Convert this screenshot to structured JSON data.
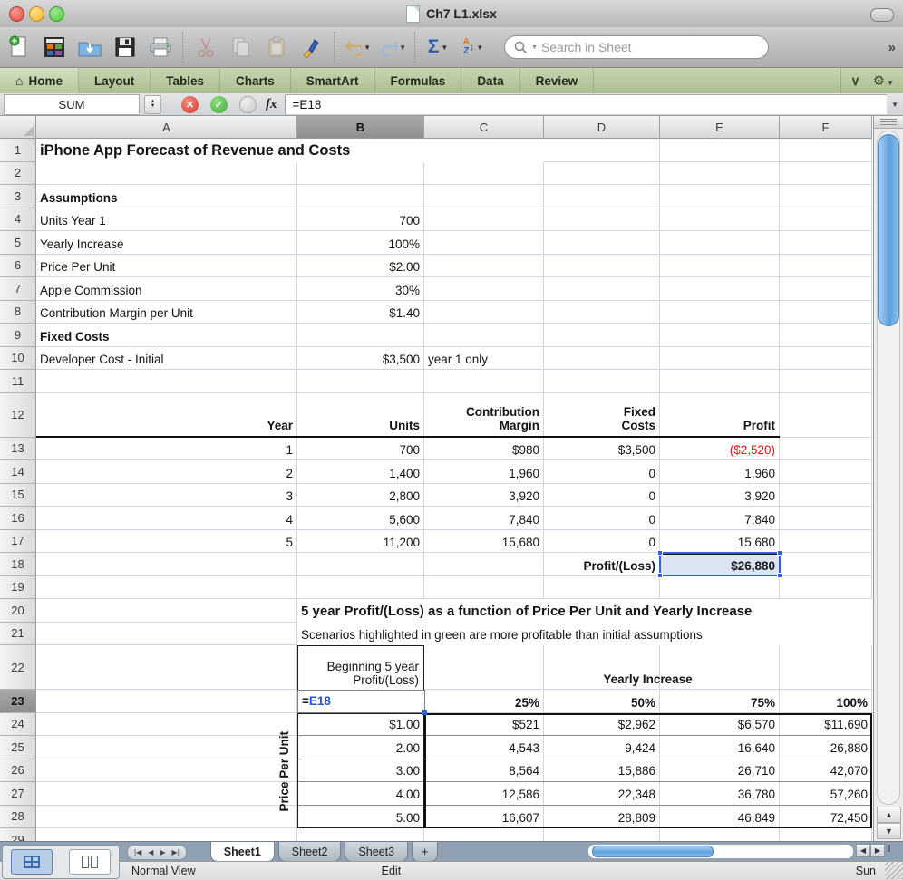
{
  "window": {
    "title": "Ch7 L1.xlsx"
  },
  "toolbar": {
    "search_placeholder": "Search in Sheet",
    "more_label": "»",
    "icons": [
      "new-document",
      "workbook-gallery",
      "open",
      "save",
      "print",
      "cut",
      "copy",
      "paste",
      "format-painter",
      "undo",
      "redo",
      "autosum",
      "sort-az",
      "search"
    ]
  },
  "ribbon": {
    "tabs": [
      "Home",
      "Layout",
      "Tables",
      "Charts",
      "SmartArt",
      "Formulas",
      "Data",
      "Review"
    ],
    "active_tab": "Home",
    "home_icon": "⌂",
    "collapse_icon": "∨",
    "gear_icon": "⚙"
  },
  "formula_bar": {
    "name_box": "SUM",
    "fx_label": "fx",
    "formula": "=E18",
    "edit_prefix": "=",
    "edit_ref": "E18"
  },
  "sheet": {
    "columns": [
      "A",
      "B",
      "C",
      "D",
      "E",
      "F"
    ],
    "selected_column": "B",
    "selected_row": 23,
    "row_count": 29,
    "vertical_label": "Price Per Unit",
    "cells": [
      {
        "r": 1,
        "c": "A",
        "t": "iPhone App Forecast of Revenue and Costs",
        "cls": "b t16 wbg",
        "span": 3
      },
      {
        "r": 3,
        "c": "A",
        "t": "Assumptions",
        "cls": "b"
      },
      {
        "r": 4,
        "c": "A",
        "t": "Units Year 1"
      },
      {
        "r": 4,
        "c": "B",
        "t": "700",
        "cls": "ar"
      },
      {
        "r": 5,
        "c": "A",
        "t": "Yearly Increase"
      },
      {
        "r": 5,
        "c": "B",
        "t": "100%",
        "cls": "ar"
      },
      {
        "r": 6,
        "c": "A",
        "t": "Price Per Unit"
      },
      {
        "r": 6,
        "c": "B",
        "t": "$2.00",
        "cls": "ar"
      },
      {
        "r": 7,
        "c": "A",
        "t": "Apple Commission"
      },
      {
        "r": 7,
        "c": "B",
        "t": "30%",
        "cls": "ar"
      },
      {
        "r": 8,
        "c": "A",
        "t": "Contribution Margin per Unit"
      },
      {
        "r": 8,
        "c": "B",
        "t": "$1.40",
        "cls": "ar"
      },
      {
        "r": 9,
        "c": "A",
        "t": "Fixed  Costs",
        "cls": "b"
      },
      {
        "r": 10,
        "c": "A",
        "t": "Developer Cost - Initial"
      },
      {
        "r": 10,
        "c": "B",
        "t": "$3,500",
        "cls": "ar"
      },
      {
        "r": 10,
        "c": "C",
        "t": "year 1 only"
      },
      {
        "r": 12,
        "c": "A",
        "t": "Year",
        "cls": "b ar bb2"
      },
      {
        "r": 12,
        "c": "B",
        "t": "Units",
        "cls": "b ar bb2"
      },
      {
        "r": 12,
        "c": "C",
        "t": "Contribution\nMargin",
        "cls": "b ar bb2 pre"
      },
      {
        "r": 12,
        "c": "D",
        "t": "Fixed\nCosts",
        "cls": "b ar bb2 pre"
      },
      {
        "r": 12,
        "c": "E",
        "t": "Profit",
        "cls": "b ar bb2"
      },
      {
        "r": 13,
        "c": "A",
        "t": "1",
        "cls": "ar"
      },
      {
        "r": 13,
        "c": "B",
        "t": "700",
        "cls": "ar"
      },
      {
        "r": 13,
        "c": "C",
        "t": "$980",
        "cls": "ar"
      },
      {
        "r": 13,
        "c": "D",
        "t": "$3,500",
        "cls": "ar"
      },
      {
        "r": 13,
        "c": "E",
        "t": "($2,520)",
        "cls": "ar red"
      },
      {
        "r": 14,
        "c": "A",
        "t": "2",
        "cls": "ar"
      },
      {
        "r": 14,
        "c": "B",
        "t": "1,400",
        "cls": "ar"
      },
      {
        "r": 14,
        "c": "C",
        "t": "1,960",
        "cls": "ar"
      },
      {
        "r": 14,
        "c": "D",
        "t": "0",
        "cls": "ar"
      },
      {
        "r": 14,
        "c": "E",
        "t": "1,960",
        "cls": "ar"
      },
      {
        "r": 15,
        "c": "A",
        "t": "3",
        "cls": "ar"
      },
      {
        "r": 15,
        "c": "B",
        "t": "2,800",
        "cls": "ar"
      },
      {
        "r": 15,
        "c": "C",
        "t": "3,920",
        "cls": "ar"
      },
      {
        "r": 15,
        "c": "D",
        "t": "0",
        "cls": "ar"
      },
      {
        "r": 15,
        "c": "E",
        "t": "3,920",
        "cls": "ar"
      },
      {
        "r": 16,
        "c": "A",
        "t": "4",
        "cls": "ar"
      },
      {
        "r": 16,
        "c": "B",
        "t": "5,600",
        "cls": "ar"
      },
      {
        "r": 16,
        "c": "C",
        "t": "7,840",
        "cls": "ar"
      },
      {
        "r": 16,
        "c": "D",
        "t": "0",
        "cls": "ar"
      },
      {
        "r": 16,
        "c": "E",
        "t": "7,840",
        "cls": "ar"
      },
      {
        "r": 17,
        "c": "A",
        "t": "5",
        "cls": "ar"
      },
      {
        "r": 17,
        "c": "B",
        "t": "11,200",
        "cls": "ar"
      },
      {
        "r": 17,
        "c": "C",
        "t": "15,680",
        "cls": "ar"
      },
      {
        "r": 17,
        "c": "D",
        "t": "0",
        "cls": "ar"
      },
      {
        "r": 17,
        "c": "E",
        "t": "15,680",
        "cls": "ar"
      },
      {
        "r": 18,
        "c": "D",
        "t": "Profit/(Loss)",
        "cls": "b ar"
      },
      {
        "r": 18,
        "c": "E",
        "t": "$26,880",
        "cls": "b ar bt2 selfill"
      },
      {
        "r": 20,
        "c": "B",
        "t": "5 year Profit/(Loss) as a function of Price Per Unit and Yearly Increase",
        "cls": "b t15 wbg",
        "span": 5
      },
      {
        "r": 21,
        "c": "B",
        "t": "Scenarios highlighted in green are more profitable than initial assumptions",
        "cls": "wbg",
        "span": 5
      },
      {
        "r": 22,
        "c": "B",
        "t": "Beginning 5 year\nProfit/(Loss)",
        "cls": "pre ar b22box"
      },
      {
        "r": 22,
        "c": "C",
        "t": "Yearly Increase",
        "cls": "b ac",
        "span": 4
      },
      {
        "r": 23,
        "c": "C",
        "t": "25%",
        "cls": "b ar"
      },
      {
        "r": 23,
        "c": "D",
        "t": "50%",
        "cls": "b ar"
      },
      {
        "r": 23,
        "c": "E",
        "t": "75%",
        "cls": "b ar"
      },
      {
        "r": 23,
        "c": "F",
        "t": "100%",
        "cls": "b ar"
      },
      {
        "r": 24,
        "c": "B",
        "t": "$1.00",
        "cls": "ar hb"
      },
      {
        "r": 24,
        "c": "C",
        "t": "$521",
        "cls": "ar hb"
      },
      {
        "r": 24,
        "c": "D",
        "t": "$2,962",
        "cls": "ar hb"
      },
      {
        "r": 24,
        "c": "E",
        "t": "$6,570",
        "cls": "ar hb"
      },
      {
        "r": 24,
        "c": "F",
        "t": "$11,690",
        "cls": "ar hb"
      },
      {
        "r": 25,
        "c": "B",
        "t": "2.00",
        "cls": "ar hb"
      },
      {
        "r": 25,
        "c": "C",
        "t": "4,543",
        "cls": "ar hb"
      },
      {
        "r": 25,
        "c": "D",
        "t": "9,424",
        "cls": "ar hb"
      },
      {
        "r": 25,
        "c": "E",
        "t": "16,640",
        "cls": "ar hb"
      },
      {
        "r": 25,
        "c": "F",
        "t": "26,880",
        "cls": "ar hb"
      },
      {
        "r": 26,
        "c": "B",
        "t": "3.00",
        "cls": "ar hb"
      },
      {
        "r": 26,
        "c": "C",
        "t": "8,564",
        "cls": "ar hb"
      },
      {
        "r": 26,
        "c": "D",
        "t": "15,886",
        "cls": "ar hb"
      },
      {
        "r": 26,
        "c": "E",
        "t": "26,710",
        "cls": "ar hb"
      },
      {
        "r": 26,
        "c": "F",
        "t": "42,070",
        "cls": "ar hb"
      },
      {
        "r": 27,
        "c": "B",
        "t": "4.00",
        "cls": "ar hb"
      },
      {
        "r": 27,
        "c": "C",
        "t": "12,586",
        "cls": "ar hb"
      },
      {
        "r": 27,
        "c": "D",
        "t": "22,348",
        "cls": "ar hb"
      },
      {
        "r": 27,
        "c": "E",
        "t": "36,780",
        "cls": "ar hb"
      },
      {
        "r": 27,
        "c": "F",
        "t": "57,260",
        "cls": "ar hb"
      },
      {
        "r": 28,
        "c": "B",
        "t": "5.00",
        "cls": "ar"
      },
      {
        "r": 28,
        "c": "C",
        "t": "16,607",
        "cls": "ar"
      },
      {
        "r": 28,
        "c": "D",
        "t": "28,809",
        "cls": "ar"
      },
      {
        "r": 28,
        "c": "E",
        "t": "46,849",
        "cls": "ar"
      },
      {
        "r": 28,
        "c": "F",
        "t": "72,450",
        "cls": "ar"
      }
    ]
  },
  "sheet_tabs": {
    "tabs": [
      "Sheet1",
      "Sheet2",
      "Sheet3"
    ],
    "active_tab": "Sheet1",
    "add_label": "+"
  },
  "status_bar": {
    "view_label": "Normal View",
    "mode_label": "Edit",
    "right_label": "Sun"
  },
  "colors": {
    "accent_blue": "#2e62d8",
    "negative_red": "#e01414",
    "selection_fill": "#dbe4f3",
    "ribbon_green": "#b5c79c"
  }
}
